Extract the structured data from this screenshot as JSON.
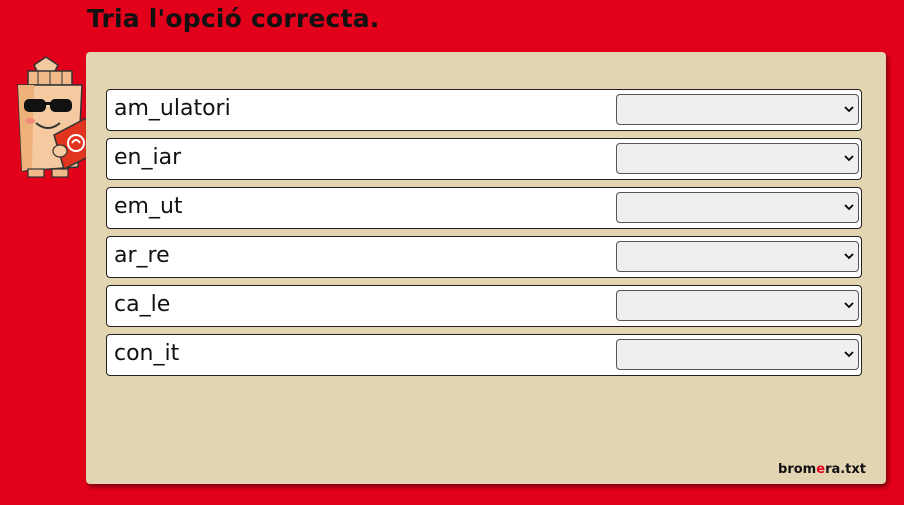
{
  "title": "Tria l'opció correcta.",
  "rows": [
    {
      "word": "am_ulatori",
      "selected": ""
    },
    {
      "word": "en_iar",
      "selected": ""
    },
    {
      "word": "em_ut",
      "selected": ""
    },
    {
      "word": "ar_re",
      "selected": ""
    },
    {
      "word": "ca_le",
      "selected": ""
    },
    {
      "word": "con_it",
      "selected": ""
    }
  ],
  "brand": {
    "part1": "brom",
    "part2": "e",
    "part3": "ra.txt",
    "accent_color": "#e2001a"
  },
  "colors": {
    "background": "#e2001a",
    "panel": "#e3d5b2",
    "row": "#ffffff",
    "select": "#efefef"
  },
  "icons": {
    "mascot": "pencil-mascot-reading-book",
    "dropdown": "chevron-down-icon"
  }
}
